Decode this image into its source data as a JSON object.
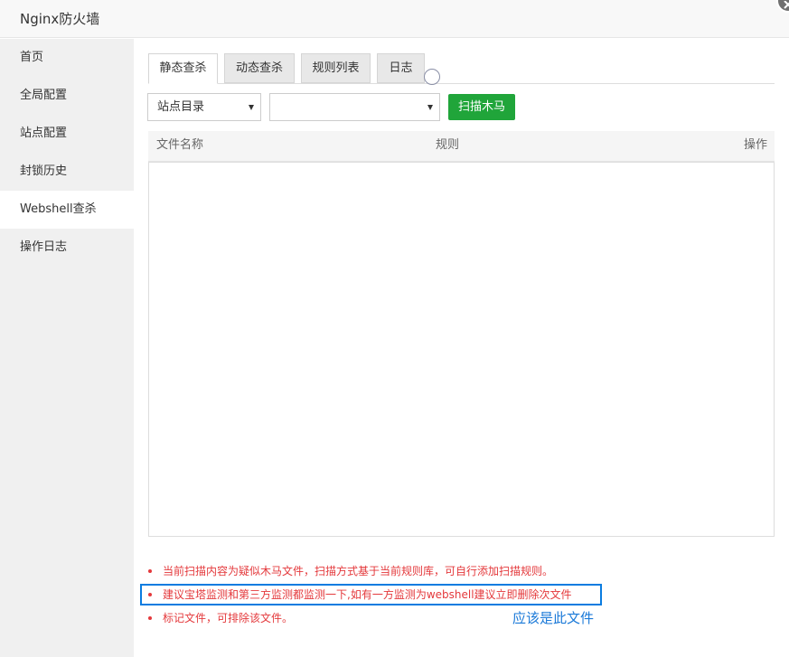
{
  "window": {
    "title": "Nginx防火墙"
  },
  "sidebar": {
    "items": [
      {
        "label": "首页"
      },
      {
        "label": "全局配置"
      },
      {
        "label": "站点配置"
      },
      {
        "label": "封锁历史"
      },
      {
        "label": "Webshell查杀",
        "active": true
      },
      {
        "label": "操作日志"
      }
    ]
  },
  "tabs": [
    {
      "label": "静态查杀",
      "active": true
    },
    {
      "label": "动态查杀"
    },
    {
      "label": "规则列表"
    },
    {
      "label": "日志"
    }
  ],
  "toolbar": {
    "site_select_value": "站点目录",
    "path_select_value": "",
    "scan_button_label": "扫描木马"
  },
  "table": {
    "columns": [
      "文件名称",
      "规则",
      "操作"
    ],
    "rows": []
  },
  "tips": [
    "当前扫描内容为疑似木马文件，扫描方式基于当前规则库，可自行添加扫描规则。",
    "建议宝塔监测和第三方监测都监测一下,如有一方监测为webshell建议立即删除次文件",
    "标记文件，可排除该文件。"
  ],
  "annotation": {
    "text": "应该是此文件"
  },
  "colors": {
    "accent_green": "#20a53a",
    "tip_red": "#e4393c",
    "highlight_blue": "#0a7ce0",
    "annotation_blue": "#1a79d8",
    "sidebar_bg": "#f0f0f0"
  }
}
